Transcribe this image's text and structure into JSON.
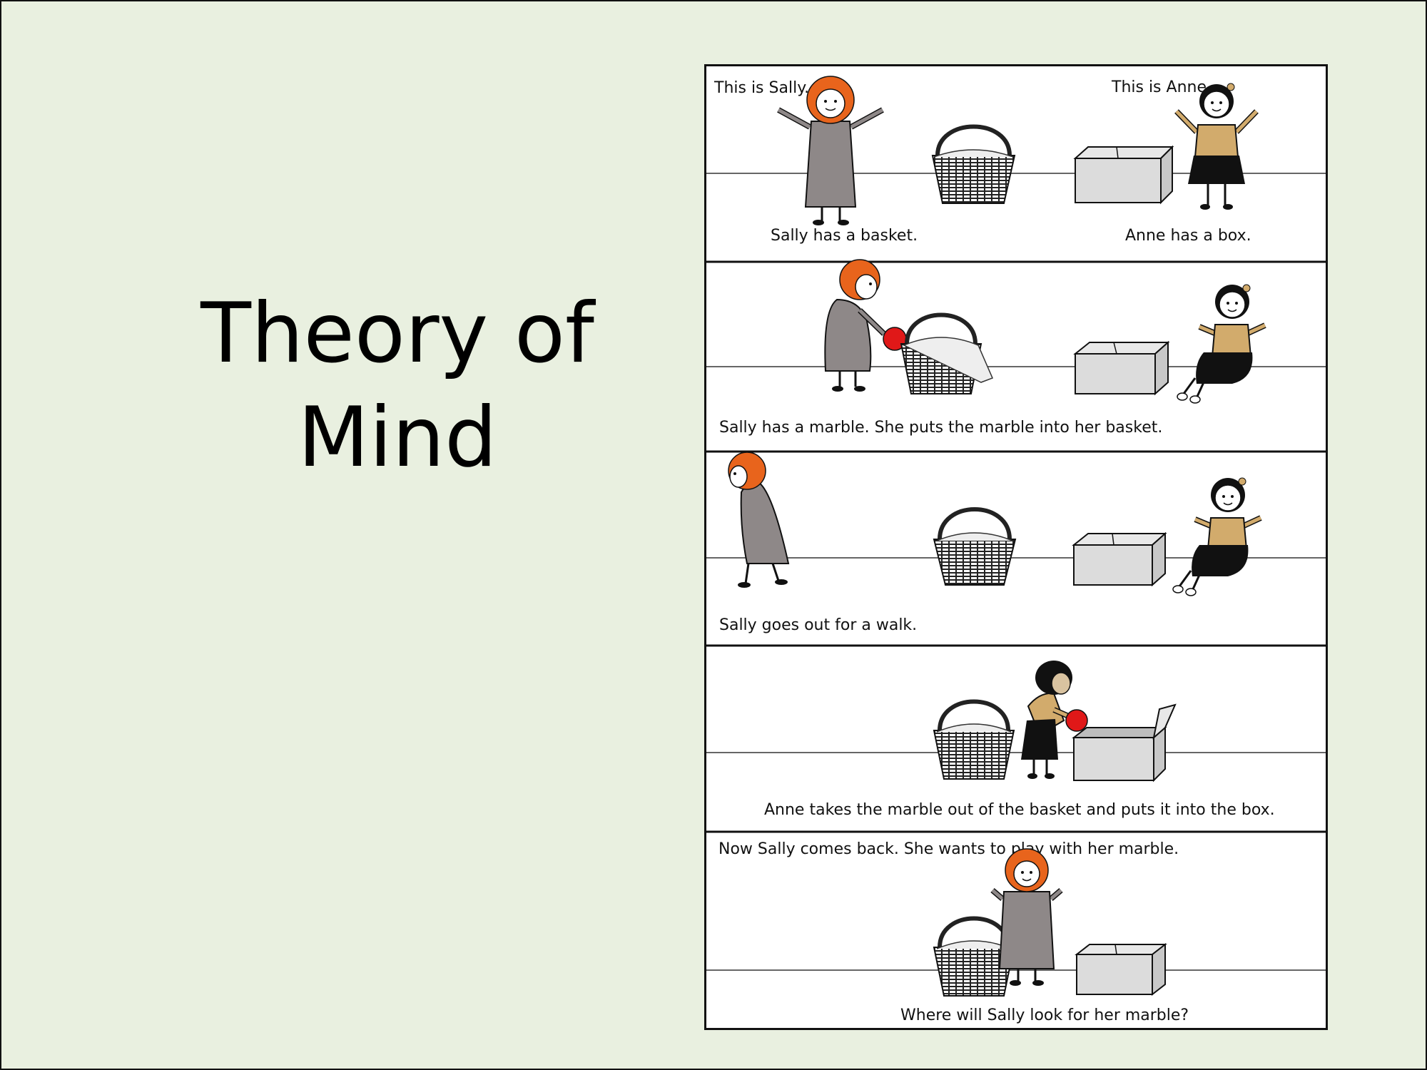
{
  "slide": {
    "title_line1": "Theory of",
    "title_line2": "Mind",
    "background_color": "#e9f0e0"
  },
  "comic": {
    "panels": [
      {
        "captions": {
          "top_left": "This is Sally.",
          "top_right": "This is Anne.",
          "bottom_left": "Sally has a basket.",
          "bottom_right": "Anne has a box."
        }
      },
      {
        "captions": {
          "bottom": "Sally has a marble. She puts the marble into her basket."
        }
      },
      {
        "captions": {
          "bottom": "Sally goes out for a walk."
        }
      },
      {
        "captions": {
          "bottom": "Anne takes the marble out of the basket and puts it into the box."
        }
      },
      {
        "captions": {
          "top": "Now Sally comes back. She wants to play with her marble.",
          "bottom": "Where will Sally look for her marble?"
        }
      }
    ],
    "colors": {
      "sally_hair": "#e8641c",
      "sally_dress": "#8e8888",
      "anne_top": "#d2ab6c",
      "anne_skirt": "#111111",
      "marble": "#e01818",
      "box": "#dcdcdc",
      "basket": "#2a2a2a"
    }
  }
}
